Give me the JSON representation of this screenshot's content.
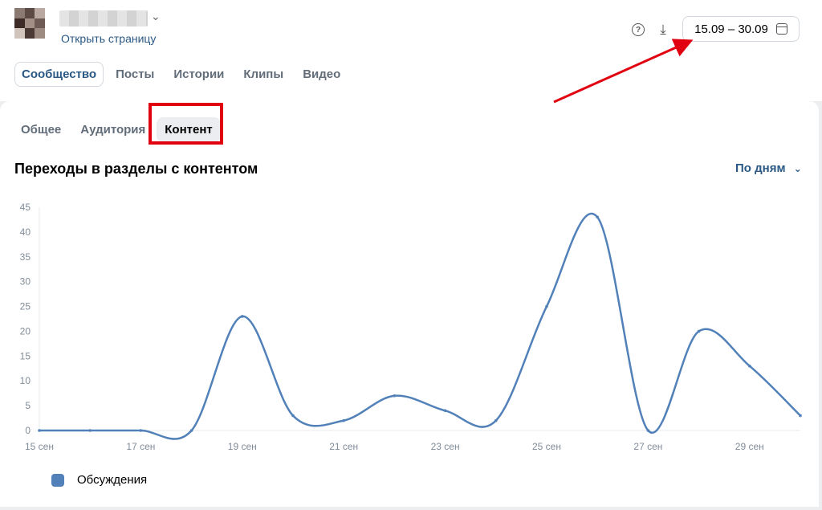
{
  "header": {
    "open_page_label": "Открыть страницу",
    "date_range": "15.09 – 30.09",
    "icons": {
      "help": "help-circle-icon",
      "download": "download-icon",
      "calendar": "calendar-icon",
      "chevron": "chevron-down-icon"
    }
  },
  "main_tabs": [
    "Сообщество",
    "Посты",
    "Истории",
    "Клипы",
    "Видео"
  ],
  "sub_tabs": [
    "Общее",
    "Аудитория",
    "Контент"
  ],
  "section": {
    "title": "Переходы в разделы с контентом",
    "period": "По дням"
  },
  "colors": {
    "accent": "#2a5885",
    "series": "#5181b8",
    "highlight": "#e0000f"
  },
  "chart_data": {
    "type": "line",
    "x": [
      "15 сен",
      "16 сен",
      "17 сен",
      "18 сен",
      "19 сен",
      "20 сен",
      "21 сен",
      "22 сен",
      "23 сен",
      "24 сен",
      "25 сен",
      "26 сен",
      "27 сен",
      "28 сен",
      "29 сен",
      "30 сен"
    ],
    "xtick_labels": [
      "15 сен",
      "17 сен",
      "19 сен",
      "21 сен",
      "23 сен",
      "25 сен",
      "27 сен",
      "29 сен"
    ],
    "series": [
      {
        "name": "Обсуждения",
        "values": [
          0,
          0,
          0,
          0,
          23,
          3,
          2,
          7,
          4,
          2,
          25,
          43,
          0,
          20,
          13,
          3
        ]
      }
    ],
    "yticks": [
      0,
      5,
      10,
      15,
      20,
      25,
      30,
      35,
      40,
      45
    ],
    "ylim": [
      0,
      45
    ],
    "grid": false,
    "legend": "bottom-left"
  }
}
